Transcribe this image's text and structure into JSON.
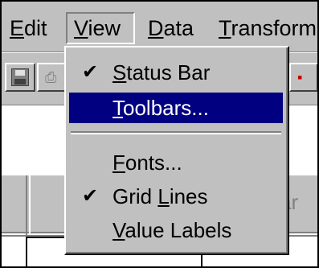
{
  "menubar": {
    "items": [
      {
        "label": "Edit"
      },
      {
        "label": "View"
      },
      {
        "label": "Data"
      },
      {
        "label": "Transform"
      }
    ]
  },
  "view_menu": {
    "items": [
      {
        "label": "Status Bar",
        "checked": true
      },
      {
        "label": "Toolbars...",
        "checked": false,
        "highlighted": true
      },
      {
        "label": "Fonts...",
        "checked": false
      },
      {
        "label": "Grid Lines",
        "checked": true
      },
      {
        "label": "Value Labels",
        "checked": false
      }
    ]
  },
  "sheet": {
    "header_fragment": "ar"
  },
  "colors": {
    "face": "#c0c0c0",
    "highlight": "#000080",
    "shadow": "#808080"
  }
}
